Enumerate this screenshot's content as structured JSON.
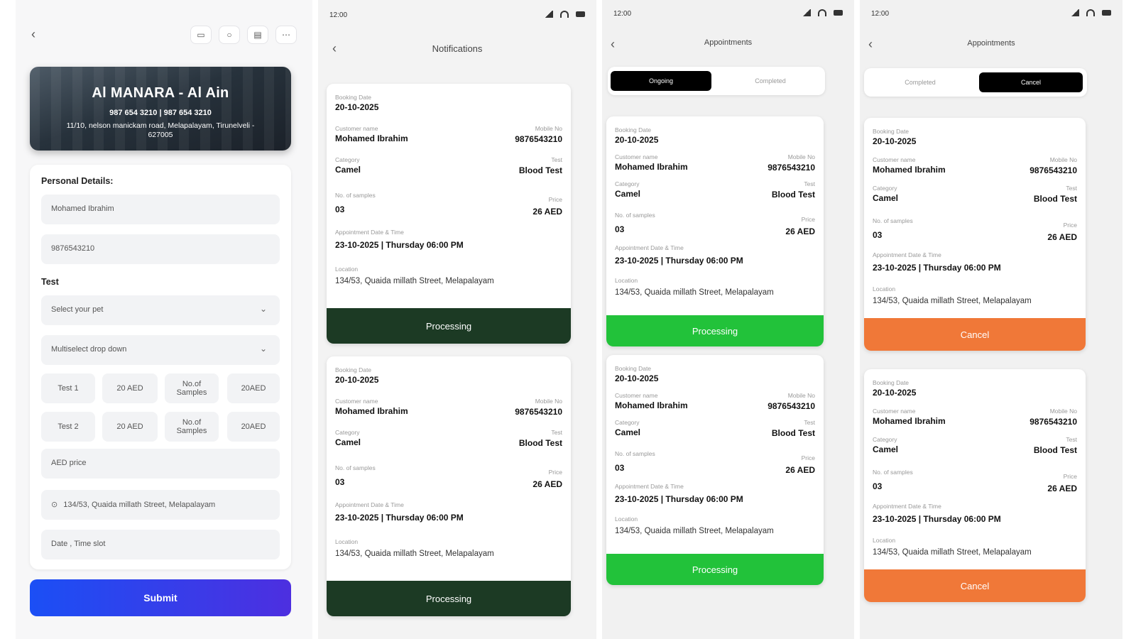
{
  "screen1": {
    "venue": {
      "name": "Al MANARA - Al Ain",
      "phones": "987 654 3210  |  987 654 3210",
      "address": "11/10, nelson manickam road, Melapalayam, Tirunelveli - 627005"
    },
    "personal_details_label": "Personal Details:",
    "name_value": "Mohamed Ibrahim",
    "phone_value": "9876543210",
    "test_label": "Test",
    "pet_placeholder": "Select your pet",
    "multiselect_placeholder": "Multiselect drop down",
    "test_rows": [
      {
        "name": "Test 1",
        "price": "20 AED",
        "samples": "No.of Samples",
        "total": "20AED"
      },
      {
        "name": "Test 2",
        "price": "20 AED",
        "samples": "No.of Samples",
        "total": "20AED"
      }
    ],
    "price_placeholder": "AED price",
    "location_value": "134/53, Quaida millath Street, Melapalayam",
    "datetime_placeholder": "Date , Time slot",
    "submit_label": "Submit"
  },
  "screen2": {
    "status_time": "12:00",
    "title": "Notifications"
  },
  "screen3": {
    "status_time": "12:00",
    "title": "Appointments",
    "tabs": [
      "Ongoing",
      "Completed"
    ]
  },
  "screen4": {
    "status_time": "12:00",
    "title": "Appointments",
    "tabs": [
      "Completed",
      "Cancel"
    ]
  },
  "booking": {
    "booking_date_label": "Booking Date",
    "booking_date": "20-10-2025",
    "customer_label": "Customer name",
    "customer": "Mohamed Ibrahim",
    "mobile_label": "Mobile No",
    "mobile": "9876543210",
    "category_label": "Category",
    "category": "Camel",
    "test_label": "Test",
    "test": "Blood Test",
    "samples_label": "No. of samples",
    "samples": "03",
    "price_label": "Price",
    "price": "26 AED",
    "appt_label": "Appointment Date & Time",
    "appt": "23-10-2025  |  Thursday 06:00 PM",
    "location_label": "Location",
    "location": "134/53, Quaida millath Street, Melapalayam"
  },
  "actions": {
    "processing": "Processing",
    "cancel": "Cancel"
  },
  "colors": {
    "processing_dark": "#1c3a24",
    "processing_green": "#22c23a",
    "cancel_orange": "#f07838",
    "submit_start": "#1b4ff5",
    "submit_end": "#4d2fe0"
  }
}
